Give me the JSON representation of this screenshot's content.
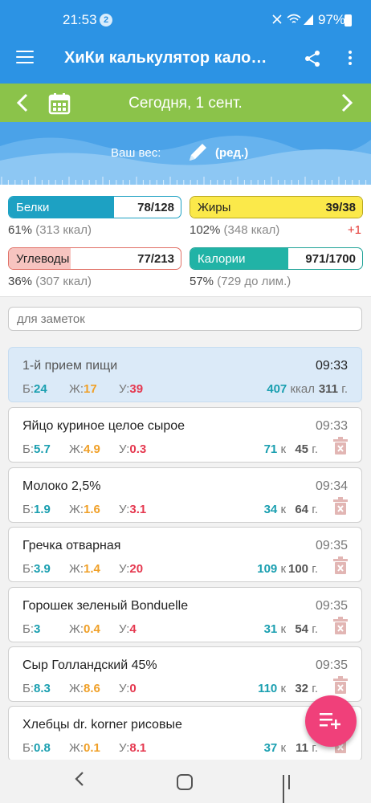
{
  "status": {
    "time": "21:53",
    "notif_count": "2",
    "battery": "97%"
  },
  "appbar": {
    "title": "ХиКи калькулятор кало…"
  },
  "datebar": {
    "date": "Сегодня, 1 сент."
  },
  "weight": {
    "label": "Ваш вес:",
    "edit": "(ред.)"
  },
  "macros": [
    {
      "name": "Белки",
      "value": "78/128",
      "sub": "61%",
      "sub_kc": "(313 ккал)",
      "extra": "",
      "fill_fraction": 0.61,
      "fill": "#1da1c3",
      "border": "#1da1c3"
    },
    {
      "name": "Жиры",
      "value": "39/38",
      "sub": "102%",
      "sub_kc": "(348 ккал)",
      "extra": "+1",
      "fill_fraction": 1.0,
      "fill": "#fbe94a",
      "border": "#b9a820"
    },
    {
      "name": "Углеводы",
      "value": "77/213",
      "sub": "36%",
      "sub_kc": "(307 ккал)",
      "extra": "",
      "fill_fraction": 0.36,
      "fill": "#f7c4c0",
      "border": "#e07066"
    },
    {
      "name": "Калории",
      "value": "971/1700",
      "sub": "57%",
      "sub_kc": "(729 до лим.)",
      "extra": "",
      "fill_fraction": 0.57,
      "fill": "#21b3a6",
      "border": "#21a398"
    }
  ],
  "notes": {
    "placeholder": "для заметок"
  },
  "meal_header": {
    "name": "1-й прием пищи",
    "time": "09:33",
    "b_label": "Б:",
    "b": "24",
    "z_label": "Ж:",
    "z": "17",
    "u_label": "У:",
    "u": "39",
    "kcal": "407",
    "kcal_unit": "ккал",
    "grams": "311",
    "grams_unit": "г."
  },
  "items": [
    {
      "name": "Яйцо куриное целое сырое",
      "time": "09:33",
      "b_label": "Б:",
      "b": "5.7",
      "z_label": "Ж:",
      "z": "4.9",
      "u_label": "У:",
      "u": "0.3",
      "kcal": "71",
      "kcal_unit": "к",
      "grams": "45",
      "grams_unit": "г."
    },
    {
      "name": "Молоко 2,5%",
      "time": "09:34",
      "b_label": "Б:",
      "b": "1.9",
      "z_label": "Ж:",
      "z": "1.6",
      "u_label": "У:",
      "u": "3.1",
      "kcal": "34",
      "kcal_unit": "к",
      "grams": "64",
      "grams_unit": "г."
    },
    {
      "name": "Гречка отварная",
      "time": "09:35",
      "b_label": "Б:",
      "b": "3.9",
      "z_label": "Ж:",
      "z": "1.4",
      "u_label": "У:",
      "u": "20",
      "kcal": "109",
      "kcal_unit": "к",
      "grams": "100",
      "grams_unit": "г."
    },
    {
      "name": "Горошек зеленый Bonduelle",
      "time": "09:35",
      "b_label": "Б:",
      "b": "3",
      "z_label": "Ж:",
      "z": "0.4",
      "u_label": "У:",
      "u": "4",
      "kcal": "31",
      "kcal_unit": "к",
      "grams": "54",
      "grams_unit": "г."
    },
    {
      "name": "Сыр Голландский 45%",
      "time": "09:35",
      "b_label": "Б:",
      "b": "8.3",
      "z_label": "Ж:",
      "z": "8.6",
      "u_label": "У:",
      "u": "0",
      "kcal": "110",
      "kcal_unit": "к",
      "grams": "32",
      "grams_unit": "г."
    },
    {
      "name": "Хлебцы dr. korner рисовые",
      "time": "",
      "b_label": "Б:",
      "b": "0.8",
      "z_label": "Ж:",
      "z": "0.1",
      "u_label": "У:",
      "u": "8.1",
      "kcal": "37",
      "kcal_unit": "к",
      "grams": "11",
      "grams_unit": "г."
    }
  ],
  "icons": {
    "menu": "menu-icon",
    "share": "share-icon",
    "more": "more-vert-icon",
    "prev": "chevron-left-icon",
    "calendar": "calendar-icon",
    "next": "chevron-right-icon",
    "pencil": "pencil-icon",
    "trash": "trash-icon",
    "fab": "add-list-icon"
  }
}
